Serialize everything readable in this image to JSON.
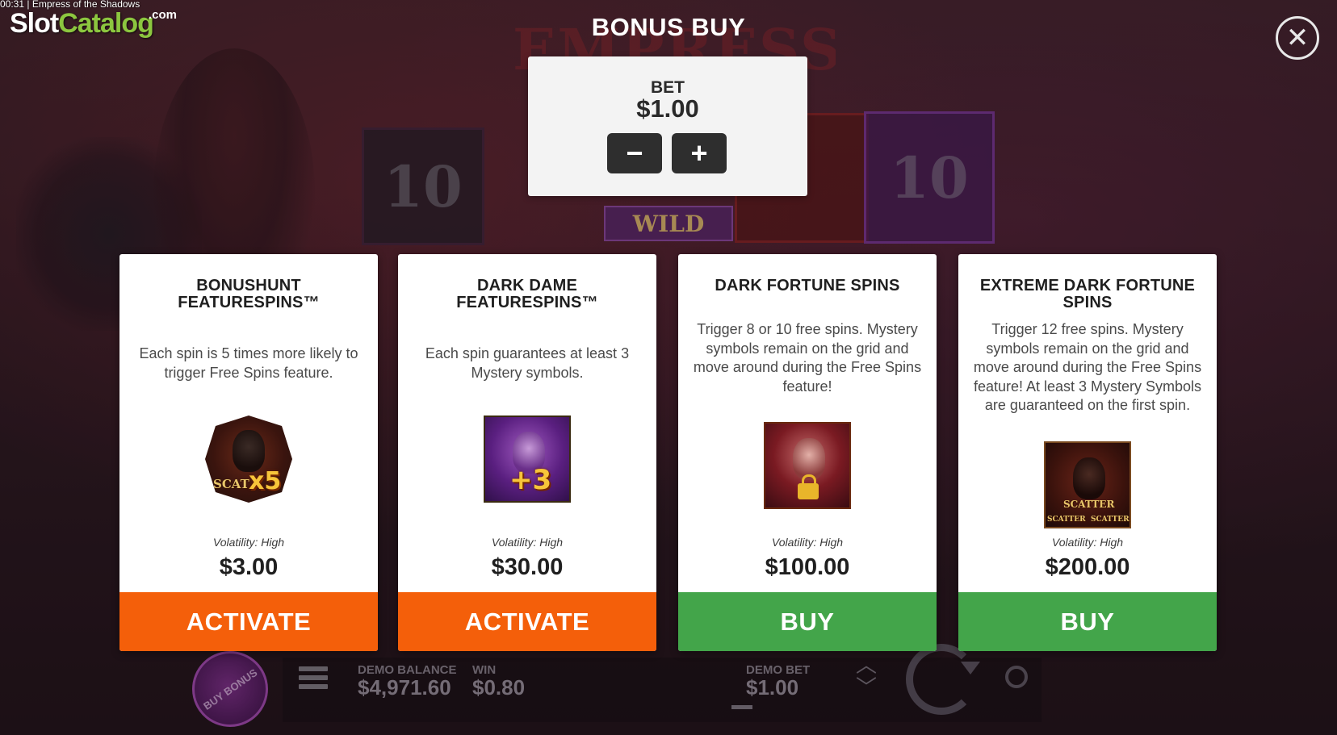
{
  "caption": "00:31 | Empress of the Shadows",
  "logo": {
    "slot": "Slot",
    "catalog": "Catalog",
    "com": ".com"
  },
  "background": {
    "title_fragment": "EMPRESS",
    "reel_symbol": "10",
    "wild_label": "WILD"
  },
  "modal": {
    "title": "BONUS BUY",
    "close_icon": "close-icon",
    "bet": {
      "label": "BET",
      "value": "$1.00",
      "minus_label": "−",
      "plus_label": "+"
    },
    "cards": [
      {
        "title": "BONUSHUNT FEATURESPINS™",
        "description": "Each spin is 5 times more likely to trigger Free Spins feature.",
        "symbol": "scatter-x5-icon",
        "symbol_text": "SCAT",
        "symbol_badge": "x5",
        "volatility": "Volatility: High",
        "price": "$3.00",
        "button": "ACTIVATE",
        "button_color": "#f45f0a"
      },
      {
        "title": "DARK DAME FEATURESPINS™",
        "description": "Each spin guarantees at least 3 Mystery symbols.",
        "symbol": "dark-dame-plus3-icon",
        "symbol_badge": "+3",
        "volatility": "Volatility: High",
        "price": "$30.00",
        "button": "ACTIVATE",
        "button_color": "#f45f0a"
      },
      {
        "title": "DARK FORTUNE SPINS",
        "description": "Trigger 8 or 10 free spins. Mystery symbols remain on the grid and move around during the Free Spins feature!",
        "symbol": "locked-empress-icon",
        "volatility": "Volatility: High",
        "price": "$100.00",
        "button": "BUY",
        "button_color": "#43a54a"
      },
      {
        "title": "EXTREME DARK FORTUNE SPINS",
        "description": "Trigger 12 free spins. Mystery symbols remain on the grid and move around during the Free Spins feature! At least 3 Mystery Symbols are guaranteed on the first spin.",
        "symbol": "triple-scatter-icon",
        "symbol_text": "SCATTER",
        "symbol_text_bottom_left": "SCATTER",
        "symbol_text_bottom_right": "SCATTER",
        "volatility": "Volatility: High",
        "price": "$200.00",
        "button": "BUY",
        "button_color": "#43a54a"
      }
    ]
  },
  "hud": {
    "buy_bonus": "BUY BONUS",
    "demo_balance_label": "DEMO BALANCE",
    "demo_balance_value": "$4,971.60",
    "win_label": "WIN",
    "win_value": "$0.80",
    "demo_bet_label": "DEMO BET",
    "demo_bet_value": "$1.00"
  }
}
